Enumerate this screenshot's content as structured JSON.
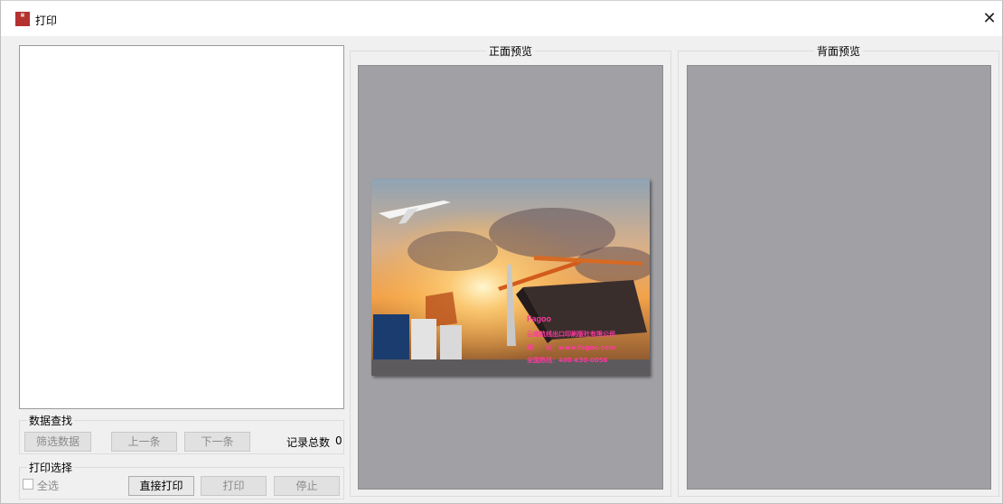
{
  "window": {
    "title": "打印",
    "close_symbol": "✕"
  },
  "search_group": {
    "title": "数据查找",
    "filter_label": "筛选数据",
    "prev_label": "上一条",
    "next_label": "下一条",
    "count_label": "记录总数",
    "count_value": "0"
  },
  "print_group": {
    "title": "打印选择",
    "select_all_label": "全选",
    "direct_print_label": "直接打印",
    "print_label": "打印",
    "stop_label": "停止"
  },
  "front_preview": {
    "title": "正面预览",
    "card": {
      "brand": "Fagoo",
      "company": "云南航线出口印刷版社有限公司",
      "website_label": "网　　址：www.fagoo.com",
      "hotline_label": "全国热线：400-630-0056"
    }
  },
  "back_preview": {
    "title": "背面预览"
  },
  "colors": {
    "canvas": "#a1a0a5",
    "window_bg": "#f0f0f0",
    "card_text": "#ff3aa0"
  }
}
